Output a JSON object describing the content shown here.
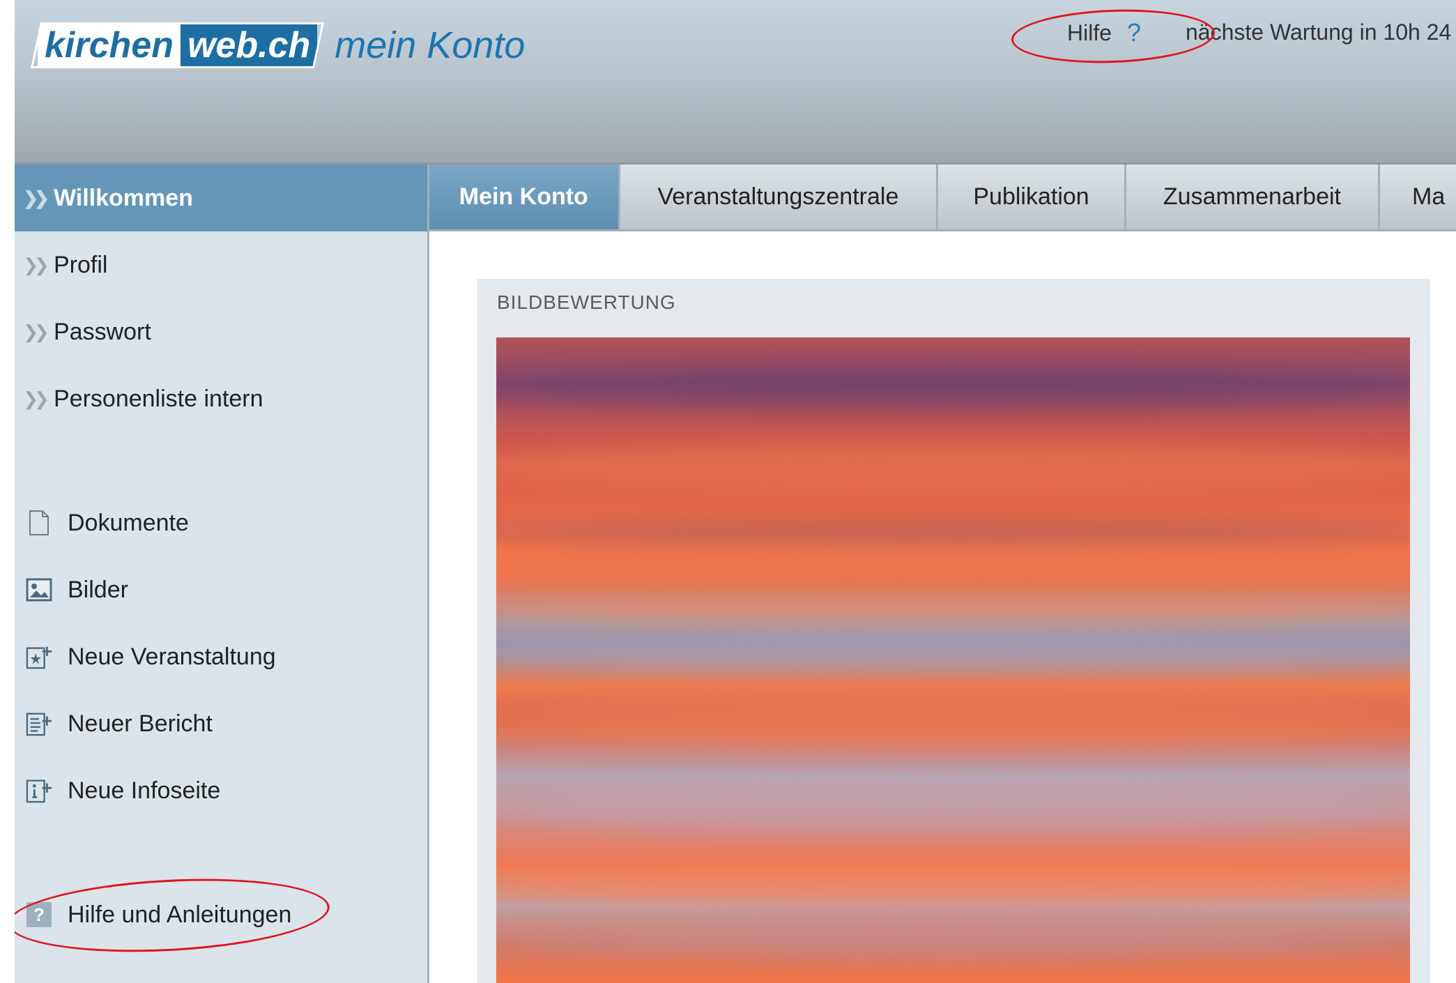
{
  "header": {
    "logo_part1": "kirchen",
    "logo_part2": "web.ch",
    "logo_tail": "mein Konto",
    "help_label": "Hilfe",
    "help_icon": "?",
    "maintenance": "nächste Wartung in 10h 24"
  },
  "sidebar": {
    "items": [
      {
        "label": "Willkommen",
        "icon": "chevron-icon"
      },
      {
        "label": "Profil",
        "icon": "chevron-icon"
      },
      {
        "label": "Passwort",
        "icon": "chevron-icon"
      },
      {
        "label": "Personenliste intern",
        "icon": "chevron-icon"
      },
      {
        "label": "Dokumente",
        "icon": "document-icon"
      },
      {
        "label": "Bilder",
        "icon": "image-icon"
      },
      {
        "label": "Neue Veranstaltung",
        "icon": "add-event-icon"
      },
      {
        "label": "Neuer Bericht",
        "icon": "add-report-icon"
      },
      {
        "label": "Neue Infoseite",
        "icon": "add-info-icon"
      },
      {
        "label": "Hilfe und Anleitungen",
        "icon": "help-icon"
      }
    ]
  },
  "tabs": [
    {
      "label": "Mein Konto"
    },
    {
      "label": "Veranstaltungszentrale"
    },
    {
      "label": "Publikation"
    },
    {
      "label": "Zusammenarbeit"
    },
    {
      "label": "Ma"
    }
  ],
  "content": {
    "panel_title": "BILDBEWERTUNG"
  },
  "colors": {
    "accent": "#6596b8",
    "brand": "#1d6fa3",
    "annotation": "#e0141f"
  }
}
